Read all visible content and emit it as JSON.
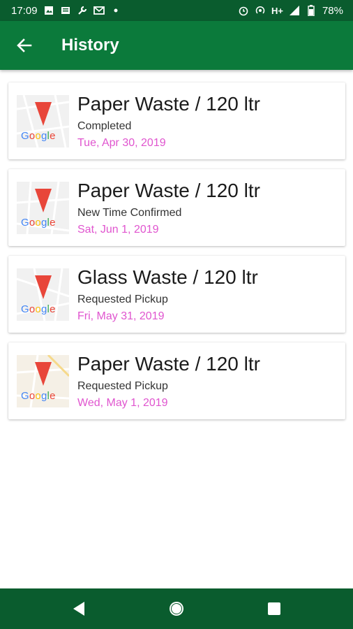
{
  "status_bar": {
    "time": "17:09",
    "network": "H+",
    "battery": "78%",
    "icons": [
      "image-icon",
      "news-icon",
      "wrench-icon",
      "gmail-icon",
      "dot-icon",
      "alarm-icon",
      "hotspot-icon",
      "signal-icon",
      "battery-icon"
    ]
  },
  "app_bar": {
    "title": "History",
    "back_icon": "arrow-back-icon"
  },
  "history": [
    {
      "title": "Paper Waste / 120 ltr",
      "status": "Completed",
      "date": "Tue, Apr 30, 2019",
      "map_logo": "Google"
    },
    {
      "title": "Paper Waste / 120 ltr",
      "status": "New Time Confirmed",
      "date": "Sat, Jun 1, 2019",
      "map_logo": "Google"
    },
    {
      "title": "Glass Waste / 120 ltr",
      "status": "Requested Pickup",
      "date": "Fri, May 31, 2019",
      "map_logo": "Google"
    },
    {
      "title": "Paper Waste / 120 ltr",
      "status": "Requested Pickup",
      "date": "Wed, May 1, 2019",
      "map_logo": "Google"
    }
  ],
  "colors": {
    "app_bar": "#0b7a3b",
    "status_bar": "#0a5c2e",
    "date_text": "#e055cf",
    "pin": "#e8463a"
  },
  "nav_bar": {
    "icons": [
      "back-triangle-icon",
      "home-circle-icon",
      "recents-square-icon"
    ]
  }
}
